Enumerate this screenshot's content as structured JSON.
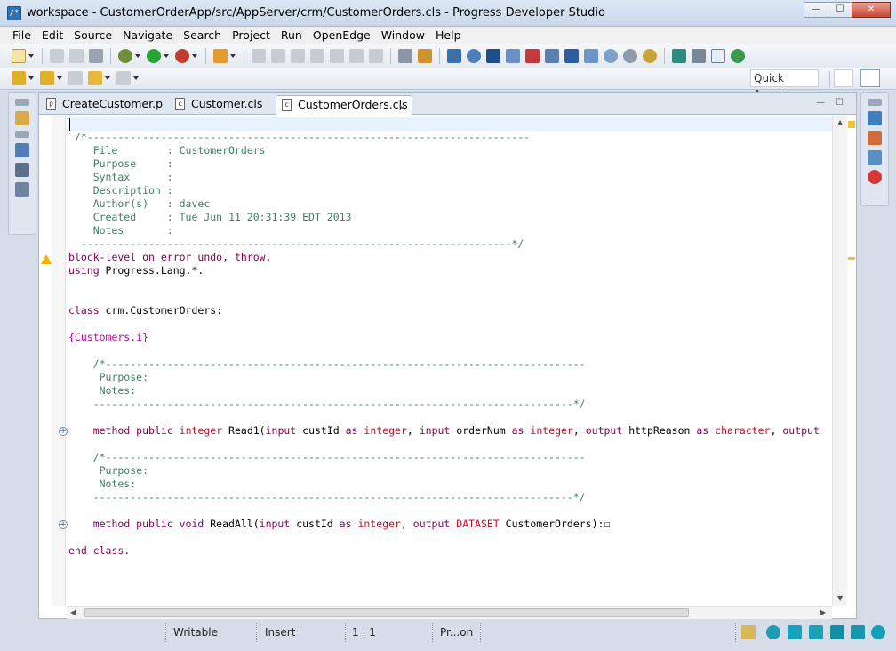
{
  "window": {
    "title": "workspace - CustomerOrderApp/src/AppServer/crm/CustomerOrders.cls - Progress Developer Studio",
    "minimize": "—",
    "maximize": "☐",
    "close": "✕"
  },
  "menu": [
    "File",
    "Edit",
    "Source",
    "Navigate",
    "Search",
    "Project",
    "Run",
    "OpenEdge",
    "Window",
    "Help"
  ],
  "toolbar": {
    "quick_access": "Quick Access"
  },
  "tabs": [
    {
      "label": "CreateCustomer.p",
      "icon": "p"
    },
    {
      "label": "Customer.cls",
      "icon": "c"
    },
    {
      "label": "CustomerOrders.cls",
      "icon": "c",
      "active": true
    }
  ],
  "code": [
    [],
    [
      [
        "c-cm",
        " /*------------------------------------------------------------------------"
      ]
    ],
    [
      [
        "c-cm",
        "    File        : CustomerOrders"
      ]
    ],
    [
      [
        "c-cm",
        "    Purpose     :"
      ]
    ],
    [
      [
        "c-cm",
        "    Syntax      :"
      ]
    ],
    [
      [
        "c-cm",
        "    Description :"
      ]
    ],
    [
      [
        "c-cm",
        "    Author(s)   : davec"
      ]
    ],
    [
      [
        "c-cm",
        "    Created     : Tue Jun 11 20:31:39 EDT 2013"
      ]
    ],
    [
      [
        "c-cm",
        "    Notes       :"
      ]
    ],
    [
      [
        "c-cm",
        "  ----------------------------------------------------------------------*/"
      ]
    ],
    [
      [
        "c-kw",
        "block-level on error undo"
      ],
      [
        "c-pl",
        ", "
      ],
      [
        "c-kw",
        "throw."
      ]
    ],
    [
      [
        "c-kw",
        "using"
      ],
      [
        "c-pl",
        " Progress.Lang.*."
      ]
    ],
    [],
    [],
    [
      [
        "c-kw",
        "class"
      ],
      [
        "c-pl",
        " crm.CustomerOrders:"
      ]
    ],
    [],
    [
      [
        "c-inc",
        "{Customers.i}"
      ]
    ],
    [],
    [
      [
        "c-cm",
        "    /*------------------------------------------------------------------------------"
      ]
    ],
    [
      [
        "c-cm",
        "     Purpose:"
      ]
    ],
    [
      [
        "c-cm",
        "     Notes:"
      ]
    ],
    [
      [
        "c-cm",
        "    ------------------------------------------------------------------------------*/"
      ]
    ],
    [],
    [
      [
        "c-pl",
        "    "
      ],
      [
        "c-kw",
        "method public"
      ],
      [
        "c-pl",
        " "
      ],
      [
        "c-ty",
        "integer"
      ],
      [
        "c-pl",
        " Read1("
      ],
      [
        "c-kw",
        "input"
      ],
      [
        "c-pl",
        " custId "
      ],
      [
        "c-kw",
        "as"
      ],
      [
        "c-pl",
        " "
      ],
      [
        "c-ty",
        "integer"
      ],
      [
        "c-pl",
        ", "
      ],
      [
        "c-kw",
        "input"
      ],
      [
        "c-pl",
        " orderNum "
      ],
      [
        "c-kw",
        "as"
      ],
      [
        "c-pl",
        " "
      ],
      [
        "c-ty",
        "integer"
      ],
      [
        "c-pl",
        ", "
      ],
      [
        "c-kw",
        "output"
      ],
      [
        "c-pl",
        " httpReason "
      ],
      [
        "c-kw",
        "as"
      ],
      [
        "c-pl",
        " "
      ],
      [
        "c-ty",
        "character"
      ],
      [
        "c-pl",
        ", "
      ],
      [
        "c-kw",
        "output"
      ]
    ],
    [],
    [
      [
        "c-cm",
        "    /*------------------------------------------------------------------------------"
      ]
    ],
    [
      [
        "c-cm",
        "     Purpose:"
      ]
    ],
    [
      [
        "c-cm",
        "     Notes:"
      ]
    ],
    [
      [
        "c-cm",
        "    ------------------------------------------------------------------------------*/"
      ]
    ],
    [],
    [
      [
        "c-pl",
        "    "
      ],
      [
        "c-kw",
        "method public void"
      ],
      [
        "c-pl",
        " ReadAll("
      ],
      [
        "c-kw",
        "input"
      ],
      [
        "c-pl",
        " custId "
      ],
      [
        "c-kw",
        "as"
      ],
      [
        "c-pl",
        " "
      ],
      [
        "c-ty",
        "integer"
      ],
      [
        "c-pl",
        ", "
      ],
      [
        "c-kw",
        "output"
      ],
      [
        "c-pl",
        " "
      ],
      [
        "c-ty",
        "DATASET"
      ],
      [
        "c-pl",
        " CustomerOrders):"
      ],
      [
        "c-pl",
        "☐"
      ]
    ],
    [],
    [
      [
        "c-kw",
        "end class."
      ]
    ]
  ],
  "status": {
    "writable": "Writable",
    "insert": "Insert",
    "position": "1 : 1",
    "progress": "Pr...on"
  }
}
